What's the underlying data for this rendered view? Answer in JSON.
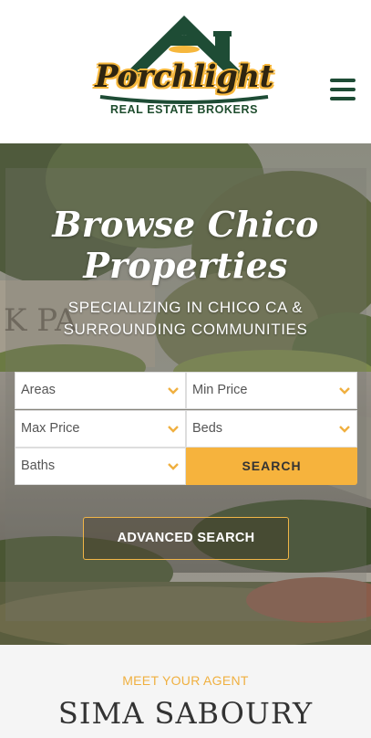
{
  "header": {
    "logo_wordmark": "Porchlight",
    "logo_tagline": "REAL ESTATE BROKERS",
    "menu_icon": "hamburger-menu-icon"
  },
  "hero": {
    "title_line1": "Browse Chico",
    "title_line2": "Properties",
    "subtitle": "SPECIALIZING IN CHICO CA & SURROUNDING COMMUNITIES",
    "search": {
      "areas": "Areas",
      "min_price": "Min Price",
      "max_price": "Max Price",
      "beds": "Beds",
      "baths": "Baths",
      "search_label": "SEARCH"
    },
    "advanced_search_label": "ADVANCED SEARCH"
  },
  "agent": {
    "eyebrow": "MEET YOUR AGENT",
    "name": "SIMA SABOURY"
  },
  "colors": {
    "brand_green": "#1e4c35",
    "accent_gold": "#f6b33d",
    "text_dark": "#333333"
  }
}
